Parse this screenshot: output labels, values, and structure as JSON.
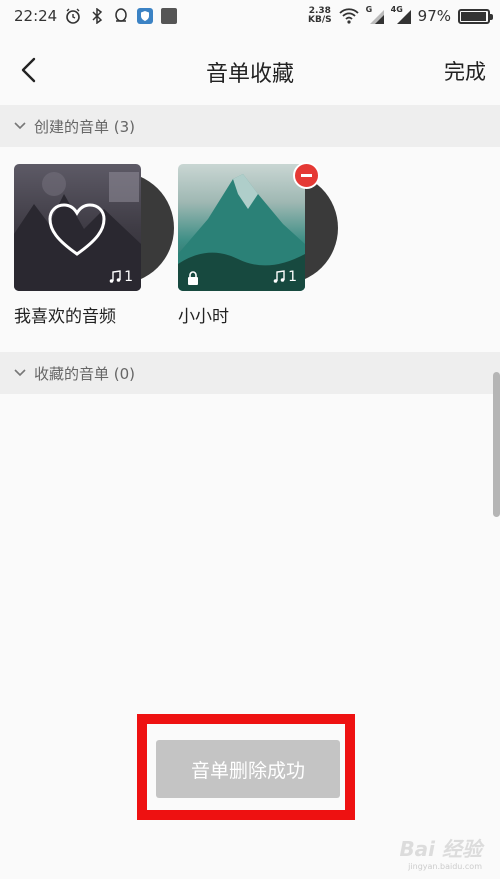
{
  "status_bar": {
    "time": "22:24",
    "left_icons": [
      "alarm-icon",
      "bluetooth-icon",
      "qq-icon",
      "shield-app-icon",
      "app-square-icon"
    ],
    "net_speed_value": "2.38",
    "net_speed_unit": "KB/S",
    "signal_labels": [
      "G",
      "4G"
    ],
    "battery_percent": "97%",
    "battery_level": 0.97
  },
  "header": {
    "title": "音单收藏",
    "done_label": "完成"
  },
  "sections": {
    "created": {
      "label": "创建的音单 (3)"
    },
    "favorited": {
      "label": "收藏的音单 (0)"
    }
  },
  "playlists": [
    {
      "name": "我喜欢的音频",
      "count": "1",
      "locked": false,
      "removable": false
    },
    {
      "name": "小小时",
      "count": "1",
      "locked": true,
      "removable": true
    }
  ],
  "toast": {
    "text": "音单删除成功"
  },
  "watermark": {
    "main": "Bai 经验",
    "sub": "jingyan.baidu.com"
  },
  "colors": {
    "accent_red": "#e53935",
    "highlight_frame": "#ee1111",
    "toast_bg": "#c4c4c4",
    "section_bg": "#eeeeee"
  }
}
